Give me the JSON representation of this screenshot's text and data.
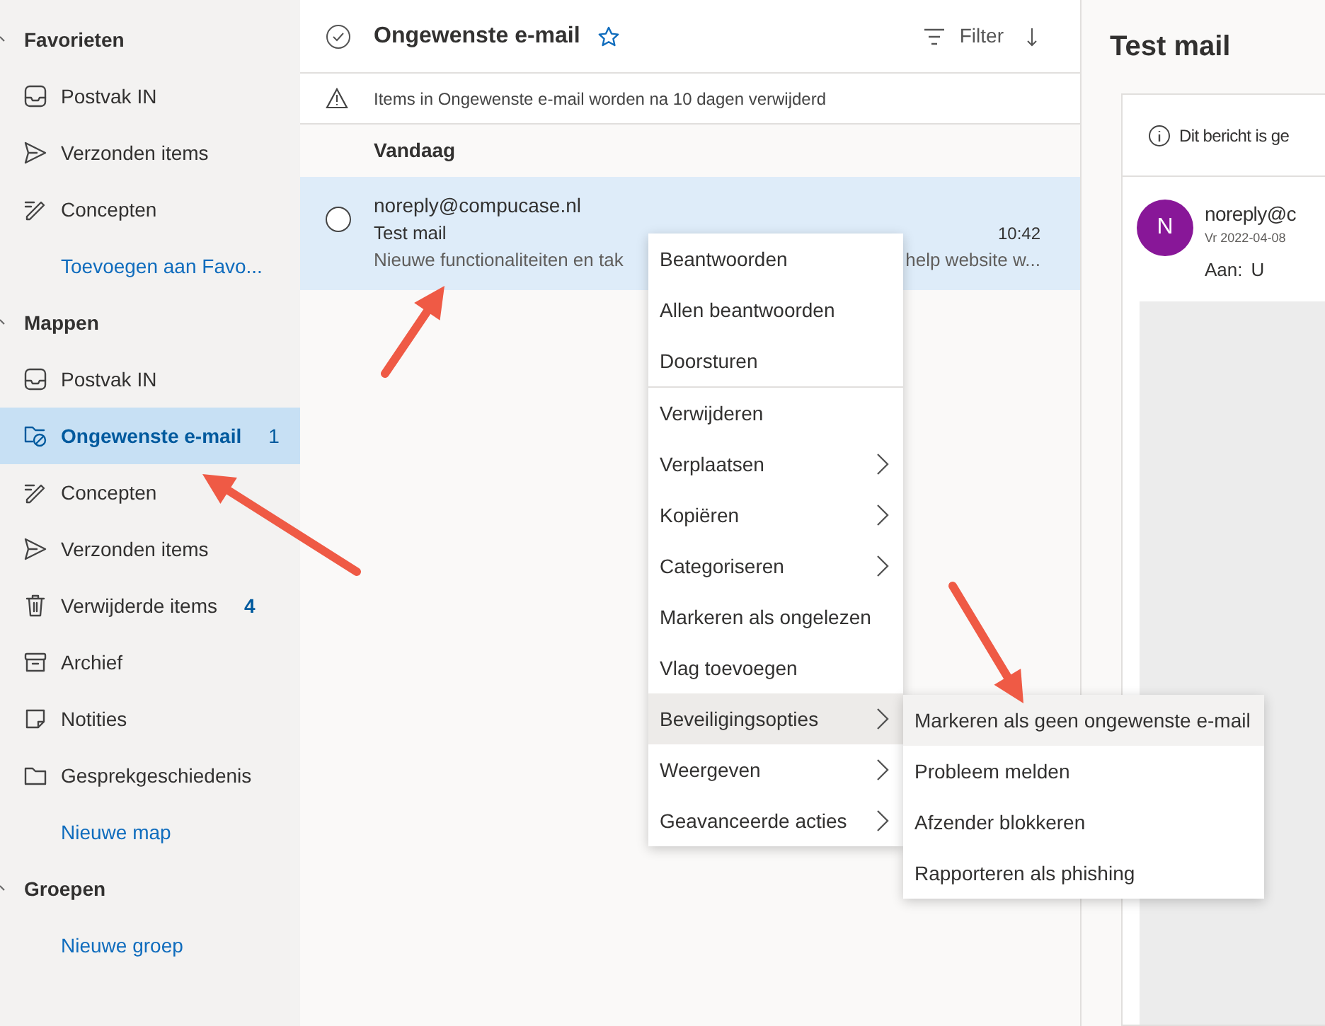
{
  "sidebar": {
    "sections": [
      {
        "title": "Favorieten",
        "items": [
          {
            "kind": "inbox",
            "label": "Postvak IN",
            "selected": false
          },
          {
            "kind": "sent",
            "label": "Verzonden items",
            "selected": false
          },
          {
            "kind": "drafts",
            "label": "Concepten",
            "selected": false
          },
          {
            "kind": "link",
            "label": "Toevoegen aan Favo...",
            "selected": false
          }
        ]
      },
      {
        "title": "Mappen",
        "items": [
          {
            "kind": "inbox",
            "label": "Postvak IN",
            "selected": false
          },
          {
            "kind": "junk",
            "label": "Ongewenste e-mail",
            "count": "1",
            "selected": true
          },
          {
            "kind": "drafts",
            "label": "Concepten",
            "selected": false
          },
          {
            "kind": "sent",
            "label": "Verzonden items",
            "selected": false
          },
          {
            "kind": "trash",
            "label": "Verwijderde items",
            "count": "4",
            "selected": false
          },
          {
            "kind": "archive",
            "label": "Archief",
            "selected": false
          },
          {
            "kind": "notes",
            "label": "Notities",
            "selected": false
          },
          {
            "kind": "history",
            "label": "Gesprekgeschiedenis",
            "selected": false
          },
          {
            "kind": "link",
            "label": "Nieuwe map",
            "selected": false
          }
        ]
      },
      {
        "title": "Groepen",
        "items": [
          {
            "kind": "link",
            "label": "Nieuwe groep",
            "selected": false
          }
        ]
      }
    ]
  },
  "message_list": {
    "title": "Ongewenste e-mail",
    "favorite": false,
    "filter": "Filter",
    "notice": "Items in Ongewenste e-mail worden na 10 dagen verwijderd",
    "groups": [
      {
        "title": "Vandaag",
        "messages": [
          {
            "sender": "noreply@compucase.nl",
            "subject": "Test mail",
            "time": "10:42",
            "preview_start": "Nieuwe functionaliteiten en tak",
            "preview_end": "help website w...",
            "selected": true,
            "checked": false
          }
        ]
      }
    ]
  },
  "context_menu": {
    "groups": [
      [
        {
          "label": "Beantwoorden",
          "submenu": false,
          "selected": false
        },
        {
          "label": "Allen beantwoorden",
          "submenu": false,
          "selected": false
        },
        {
          "label": "Doorsturen",
          "submenu": false,
          "selected": false
        }
      ],
      [
        {
          "label": "Verwijderen",
          "submenu": false,
          "selected": false
        },
        {
          "label": "Verplaatsen",
          "submenu": true,
          "selected": false
        },
        {
          "label": "Kopiëren",
          "submenu": true,
          "selected": false
        },
        {
          "label": "Categoriseren",
          "submenu": true,
          "selected": false
        },
        {
          "label": "Markeren als ongelezen",
          "submenu": false,
          "selected": false
        },
        {
          "label": "Vlag toevoegen",
          "submenu": false,
          "selected": false
        },
        {
          "label": "Beveiligingsopties",
          "submenu": true,
          "selected": true
        },
        {
          "label": "Weergeven",
          "submenu": true,
          "selected": false
        },
        {
          "label": "Geavanceerde acties",
          "submenu": true,
          "selected": false
        }
      ]
    ]
  },
  "submenu": {
    "items": [
      {
        "label": "Markeren als geen ongewenste e-mail",
        "selected": true
      },
      {
        "label": "Probleem melden",
        "selected": false
      },
      {
        "label": "Afzender blokkeren",
        "selected": false
      },
      {
        "label": "Rapporteren als phishing",
        "selected": false
      }
    ]
  },
  "reading_pane": {
    "title": "Test mail",
    "info": "Dit bericht is ge",
    "avatar": "N",
    "sender": "noreply@c",
    "date": "Vr 2022-04-08",
    "to_label": "Aan:",
    "to": "U"
  }
}
